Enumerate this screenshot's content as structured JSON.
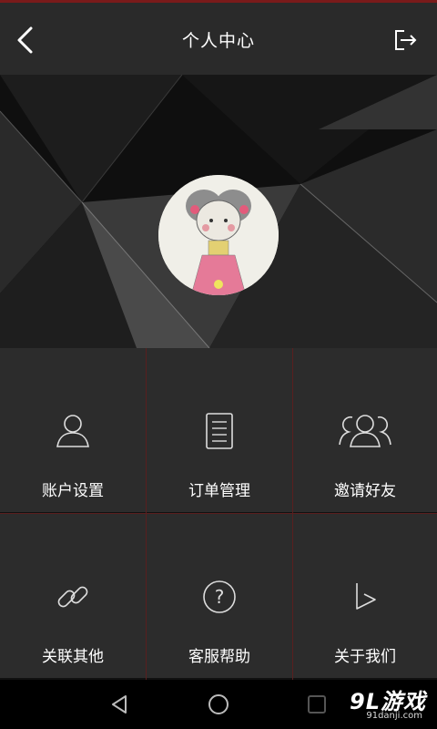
{
  "header": {
    "title": "个人中心"
  },
  "menu": [
    {
      "label": "账户设置",
      "icon": "user-icon"
    },
    {
      "label": "订单管理",
      "icon": "document-icon"
    },
    {
      "label": "邀请好友",
      "icon": "users-icon"
    },
    {
      "label": "关联其他",
      "icon": "link-icon"
    },
    {
      "label": "客服帮助",
      "icon": "help-icon"
    },
    {
      "label": "关于我们",
      "icon": "about-icon"
    }
  ],
  "watermark": {
    "brand": "9L游戏",
    "url": "91danji.com"
  },
  "colors": {
    "accent": "#7a1a1a",
    "tile_bg": "#2c2c2c",
    "topbar_bg": "#2a2a2a"
  }
}
